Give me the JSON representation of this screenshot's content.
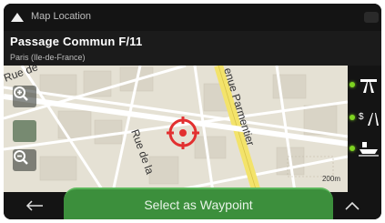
{
  "header": {
    "title": "Map Location",
    "back_icon": "triangle-up-icon"
  },
  "address": {
    "title": "Passage Commun F/11",
    "subtitle": "Paris (Ile-de-France)"
  },
  "map": {
    "street_labels": [
      "Rue de",
      "enue Parmentier",
      "Rue de la"
    ],
    "scale_label": "200m",
    "marker": "target-marker-icon"
  },
  "zoom": {
    "in_icon": "zoom-in-icon",
    "out_icon": "zoom-out-icon"
  },
  "sidebar": {
    "items": [
      {
        "icon": "highway-icon"
      },
      {
        "icon": "toll-road-icon"
      },
      {
        "icon": "ferry-icon"
      }
    ],
    "accent": "#7ed321"
  },
  "footer": {
    "back_icon": "arrow-left-icon",
    "primary_label": "Select as Waypoint",
    "expand_icon": "chevron-up-icon",
    "primary_color": "#3c8f3c"
  }
}
